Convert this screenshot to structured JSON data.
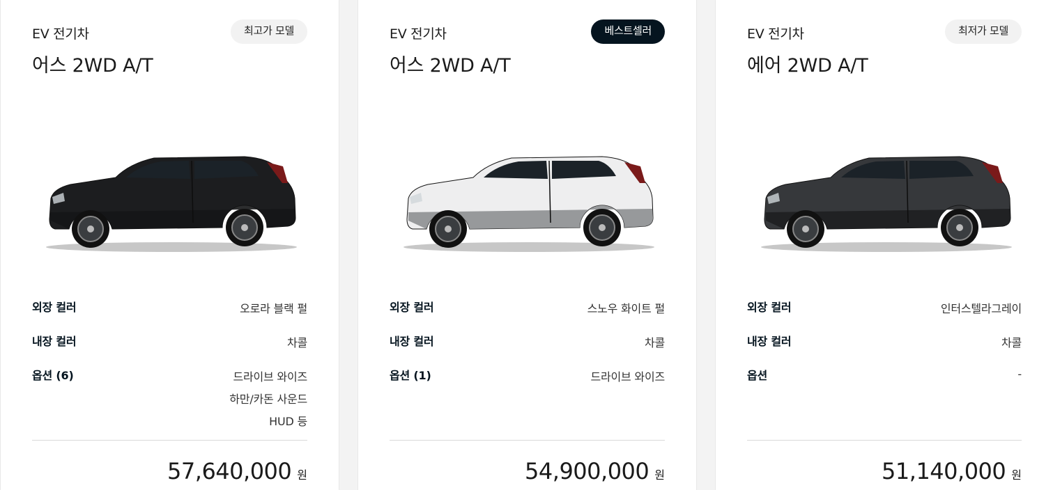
{
  "cards": [
    {
      "type": "EV 전기차",
      "badge": "최고가 모델",
      "model": "어스 2WD A/T",
      "exterior_label": "외장 컬러",
      "exterior_value": "오로라 블랙 펄",
      "interior_label": "내장 컬러",
      "interior_value": "차콜",
      "options_label": "옵션 (6)",
      "options": [
        "드라이브 와이즈",
        "하만/카돈 사운드",
        "HUD 등"
      ],
      "price": "57,640,000",
      "currency": "원",
      "body_color": "#1c1d1f",
      "lower_color": "#151617"
    },
    {
      "type": "EV 전기차",
      "badge": "베스트셀러",
      "model": "어스 2WD A/T",
      "exterior_label": "외장 컬러",
      "exterior_value": "스노우 화이트 펄",
      "interior_label": "내장 컬러",
      "interior_value": "차콜",
      "options_label": "옵션 (1)",
      "options": [
        "드라이브 와이즈"
      ],
      "price": "54,900,000",
      "currency": "원",
      "body_color": "#eeeeef",
      "lower_color": "#8d8f91"
    },
    {
      "type": "EV 전기차",
      "badge": "최저가 모델",
      "model": "에어 2WD A/T",
      "exterior_label": "외장 컬러",
      "exterior_value": "인터스텔라그레이",
      "interior_label": "내장 컬러",
      "interior_value": "차콜",
      "options_label": "옵션",
      "options": [
        "-"
      ],
      "price": "51,140,000",
      "currency": "원",
      "body_color": "#36383b",
      "lower_color": "#1e1f21"
    }
  ],
  "colors": {
    "accent_dark": "#05141f",
    "badge_light": "#f2f2f2",
    "divider": "#d9d9d9",
    "page_bg": "#f3f3f3"
  }
}
